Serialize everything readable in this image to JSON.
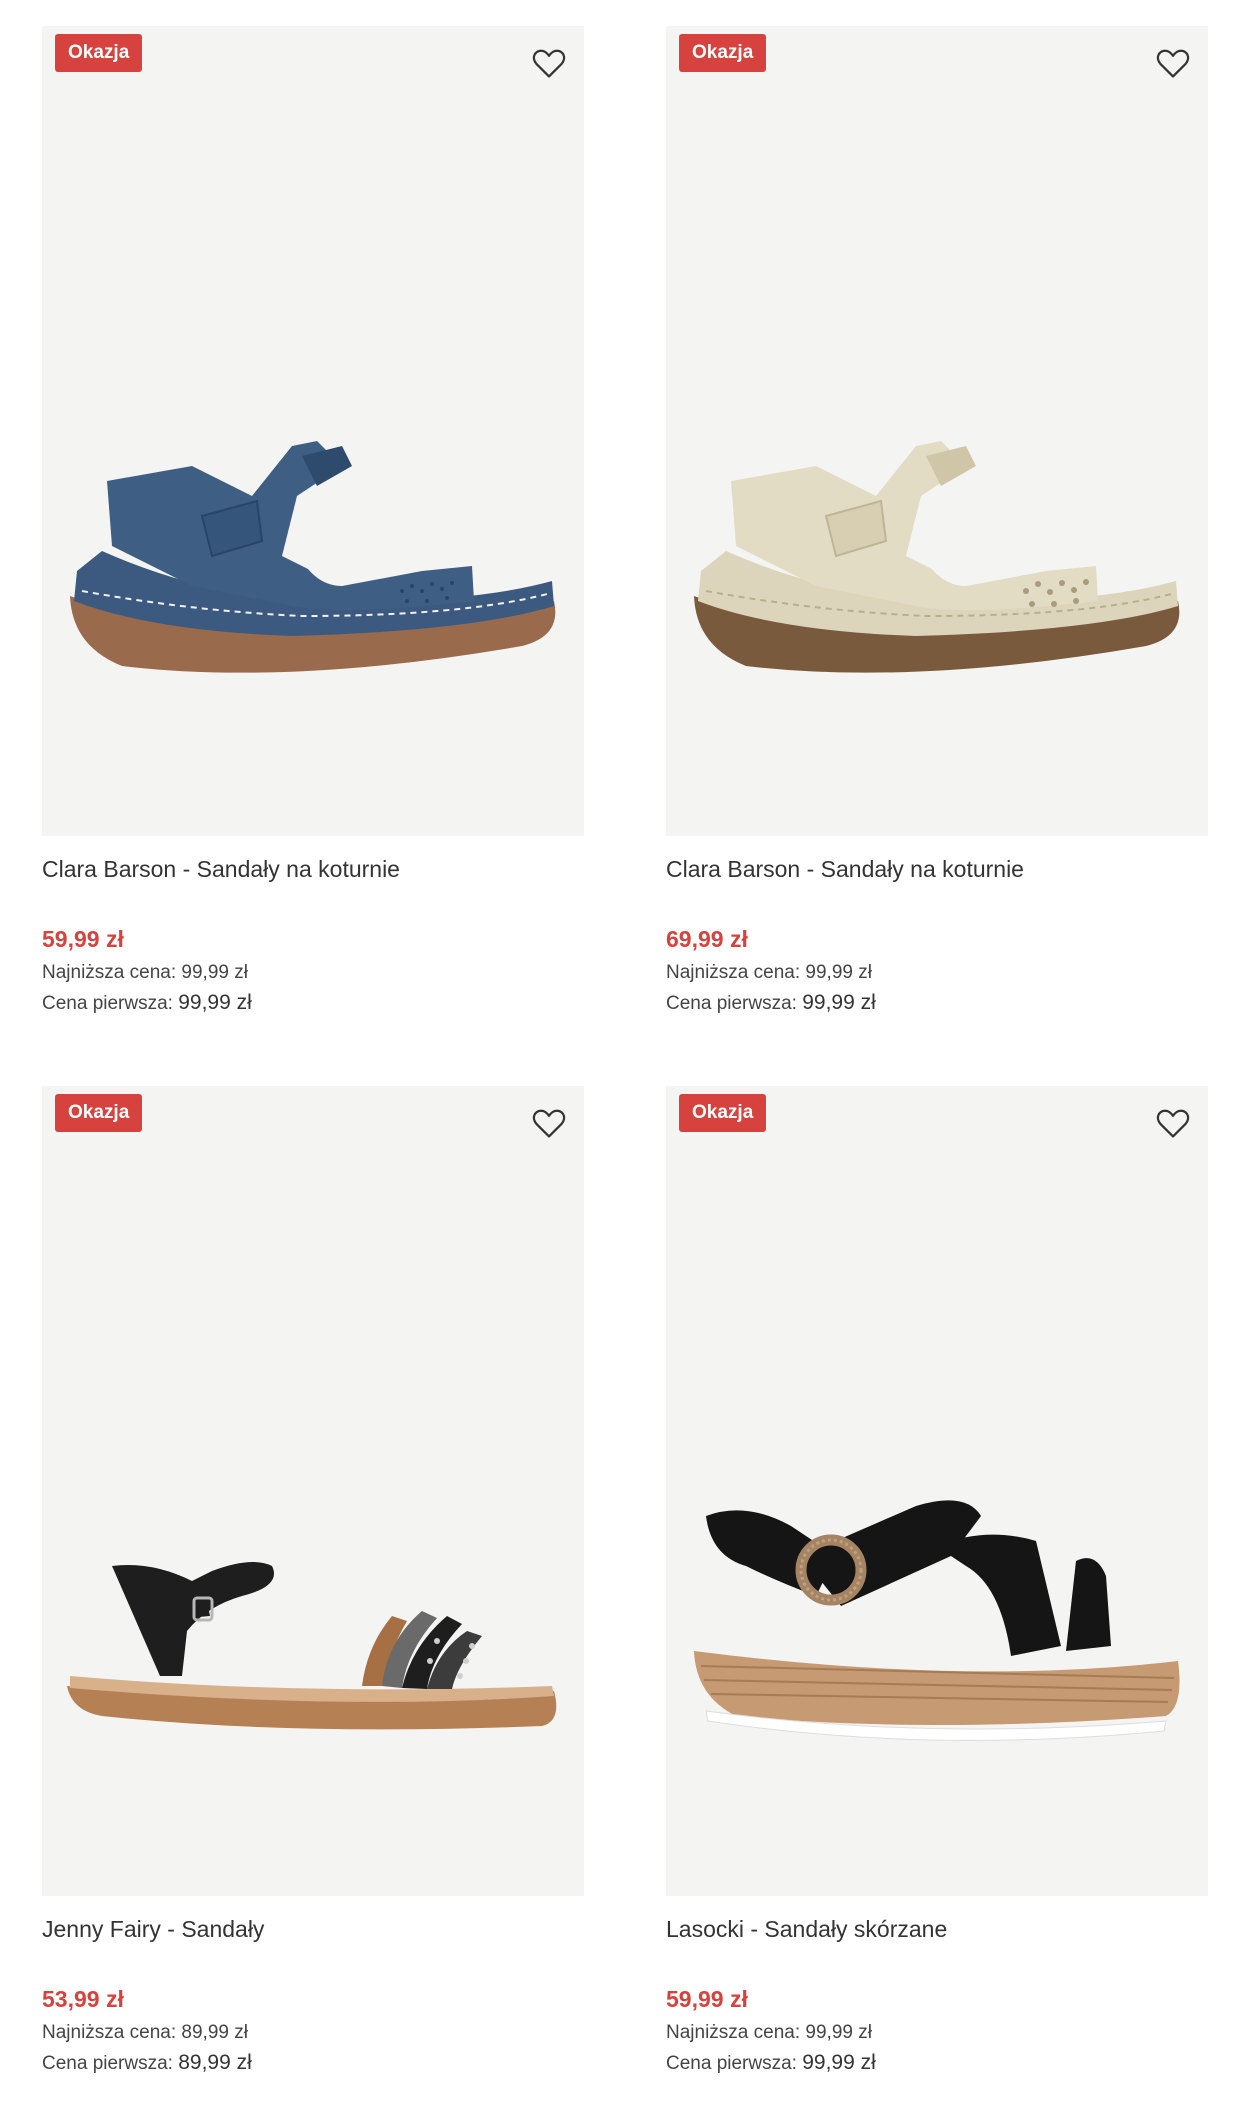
{
  "products": [
    {
      "badge": "Okazja",
      "name": "Clara Barson - Sandały na koturnie",
      "price": "59,99 zł",
      "lowest_label": "Najniższa cena:",
      "lowest_value": "99,99 zł",
      "original_label": "Cena pierwsza:",
      "original_value": "99,99 zł",
      "color": "#3f5e84"
    },
    {
      "badge": "Okazja",
      "name": "Clara Barson - Sandały na koturnie",
      "price": "69,99 zł",
      "lowest_label": "Najniższa cena:",
      "lowest_value": "99,99 zł",
      "original_label": "Cena pierwsza:",
      "original_value": "99,99 zł",
      "color": "#e3dcc4"
    },
    {
      "badge": "Okazja",
      "name": "Jenny Fairy - Sandały",
      "price": "53,99 zł",
      "lowest_label": "Najniższa cena:",
      "lowest_value": "89,99 zł",
      "original_label": "Cena pierwsza:",
      "original_value": "89,99 zł",
      "color": "#1e1e1e"
    },
    {
      "badge": "Okazja",
      "name": "Lasocki - Sandały skórzane",
      "price": "59,99 zł",
      "lowest_label": "Najniższa cena:",
      "lowest_value": "99,99 zł",
      "original_label": "Cena pierwsza:",
      "original_value": "99,99 zł",
      "color": "#151515"
    }
  ],
  "icons": {
    "favorite": "heart-outline-icon"
  },
  "colors": {
    "sale": "#d6433f",
    "image_bg": "#f4f4f3"
  }
}
